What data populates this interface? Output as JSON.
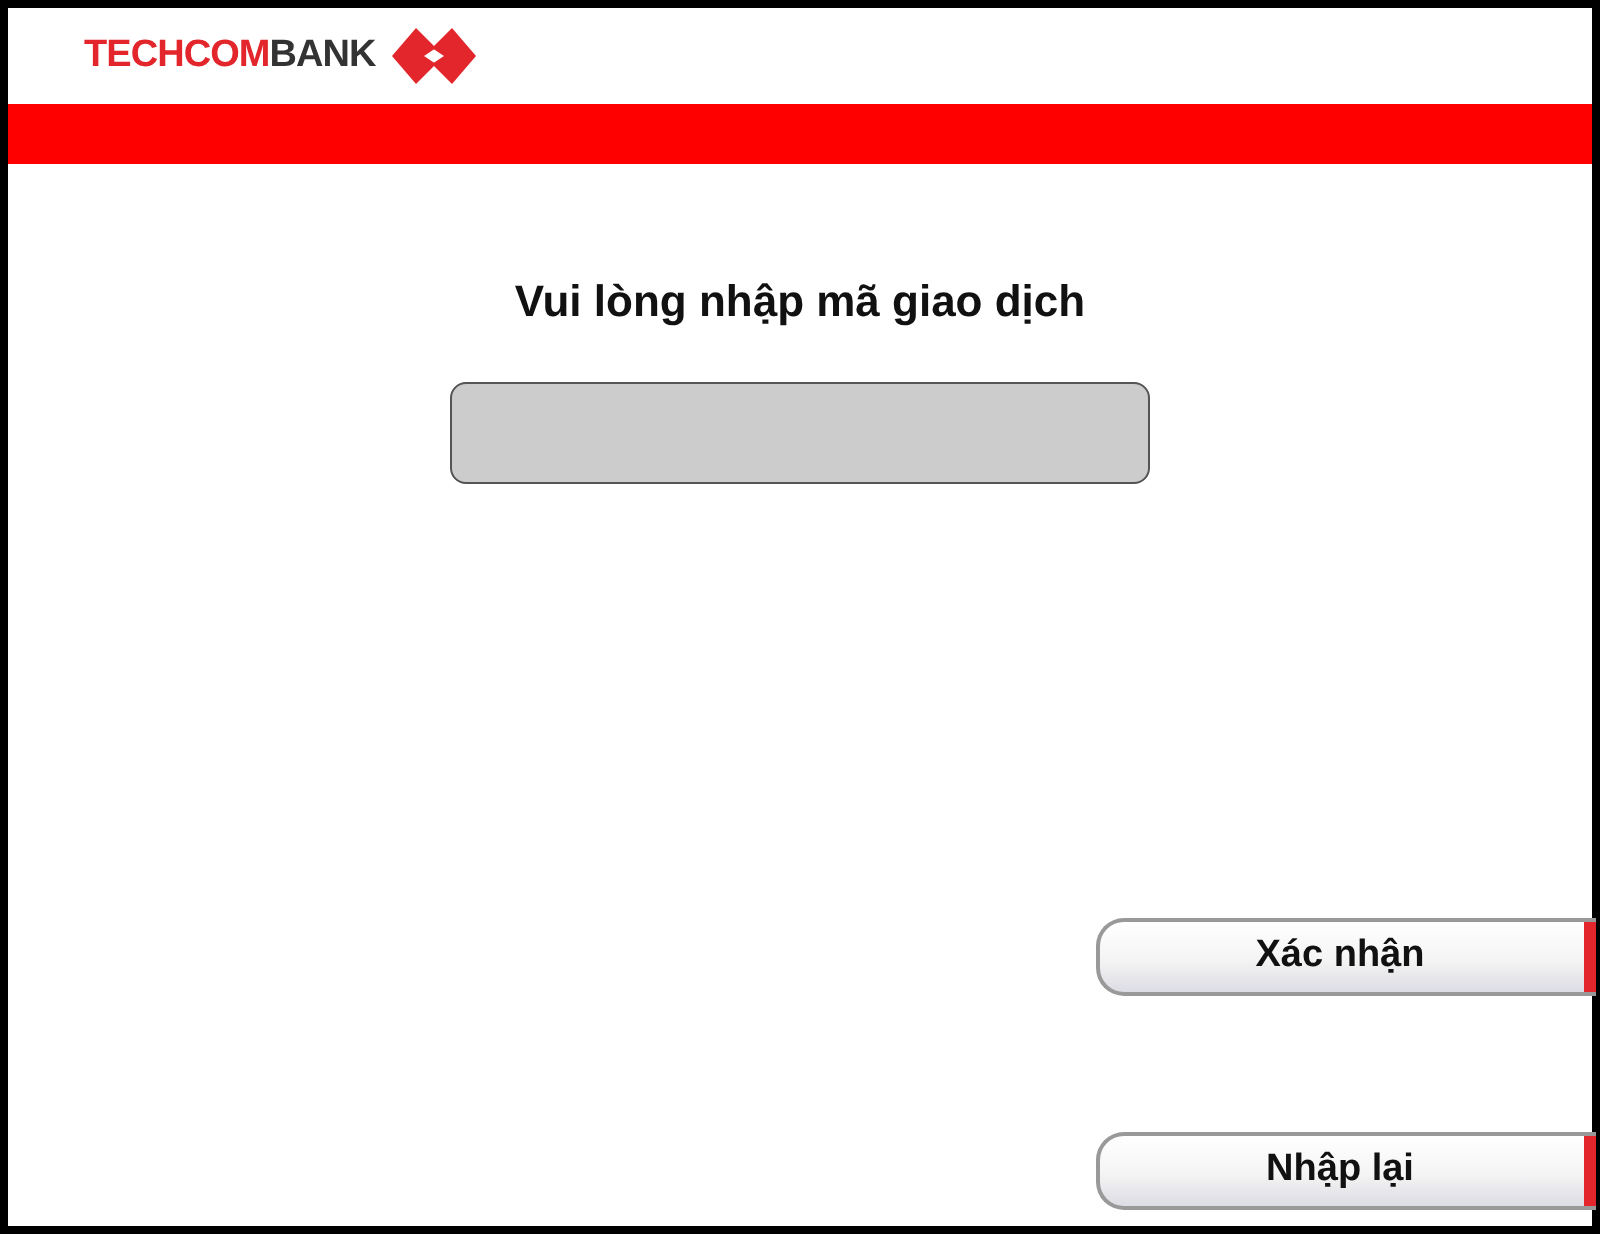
{
  "header": {
    "logo_text": [
      "TECHCOM",
      "BANK"
    ]
  },
  "prompt": "Vui lòng nhập mã giao dịch",
  "buttons": [
    {
      "label": "Xác nhận"
    },
    {
      "label": "Nhập lại"
    }
  ]
}
